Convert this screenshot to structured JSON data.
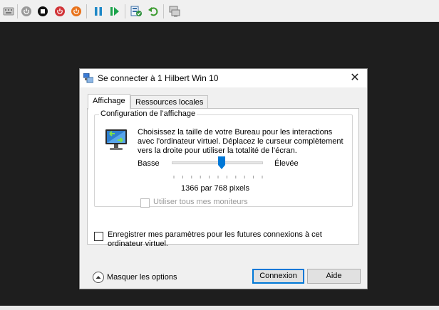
{
  "toolbar": {
    "buttons": [
      {
        "icon": "ctrl-alt-del-icon",
        "color": "#8a8a8a"
      },
      {
        "icon": "start-icon",
        "color": "#9a9a9a"
      },
      {
        "icon": "turn-off-icon",
        "color": "#111111"
      },
      {
        "icon": "shut-down-icon",
        "color": "#d13438"
      },
      {
        "icon": "power-icon",
        "color": "#e8731c"
      },
      {
        "icon": "pause-icon",
        "color": "#1e88c7"
      },
      {
        "icon": "resume-icon",
        "color": "#1aa34a"
      },
      {
        "icon": "checkpoint-icon",
        "color": "#2c8f3c"
      },
      {
        "icon": "revert-icon",
        "color": "#3a9a2e"
      },
      {
        "icon": "enhanced-session-icon",
        "color": "#8a8a8a"
      }
    ]
  },
  "dialog": {
    "title": "Se connecter à 1 Hilbert Win 10",
    "close_symbol": "✕",
    "tabs": [
      {
        "label": "Affichage",
        "active": true
      },
      {
        "label": "Ressources locales",
        "active": false
      }
    ],
    "display": {
      "group_title": "Configuration de l’affichage",
      "description": "Choisissez la taille de votre Bureau pour les interactions avec l’ordinateur virtuel. Déplacez le curseur complètement vers la droite pour utiliser la totalité de l’écran.",
      "slider_min_label": "Basse",
      "slider_max_label": "Élevée",
      "slider_position": 0.55,
      "resolution": "1366 par 768 pixels",
      "use_all_monitors_label": "Utiliser tous mes moniteurs",
      "use_all_monitors_checked": false,
      "use_all_monitors_enabled": false
    },
    "save_settings_label": "Enregistrer mes paramètres pour les futures connexions à cet ordinateur virtuel.",
    "save_settings_checked": false,
    "hide_options_label": "Masquer les options",
    "connect_label": "Connexion",
    "help_label": "Aide"
  },
  "colors": {
    "accent": "#0078d7",
    "background": "#1e1e1e"
  }
}
